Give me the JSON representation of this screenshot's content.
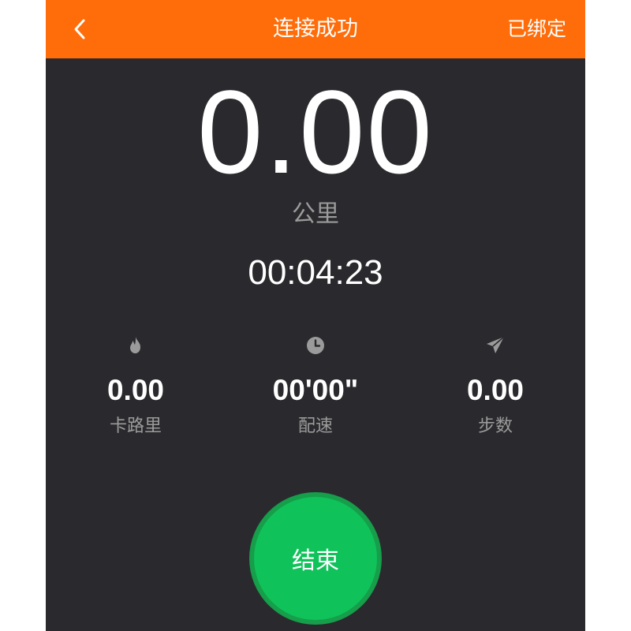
{
  "header": {
    "back_icon": "chevron-left-icon",
    "title": "连接成功",
    "bound_label": "已绑定",
    "bar_color": "#ff6d0a"
  },
  "main": {
    "distance_value": "0.00",
    "distance_unit": "公里",
    "elapsed_time": "00:04:23"
  },
  "stats": [
    {
      "icon": "flame-icon",
      "value": "0.00",
      "label": "卡路里"
    },
    {
      "icon": "clock-icon",
      "value": "00'00\"",
      "label": "配速"
    },
    {
      "icon": "paper-plane-icon",
      "value": "0.00",
      "label": "步数"
    }
  ],
  "end_button": {
    "label": "结束",
    "color": "#0fc25a"
  }
}
